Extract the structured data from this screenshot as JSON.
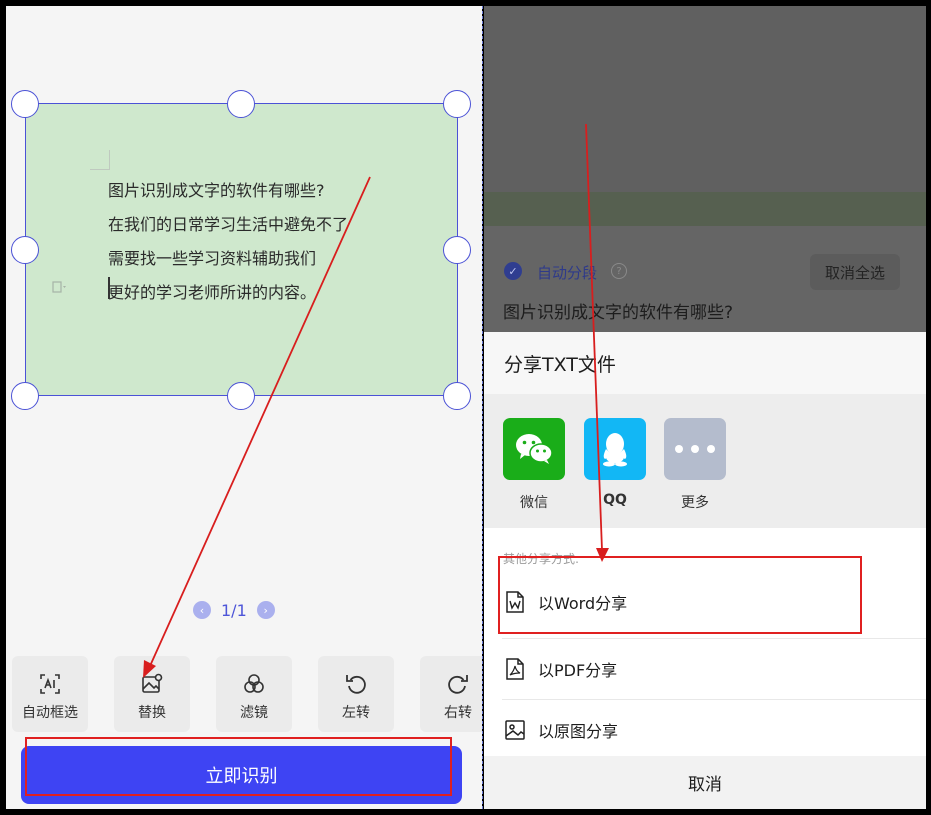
{
  "left_panel": {
    "document_lines": [
      "图片识别成文字的软件有哪些?",
      "在我们的日常学习生活中避免不了",
      "需要找一些学习资料辅助我们",
      "更好的学习老师所讲的内容。"
    ],
    "pager": {
      "prev": "‹",
      "text": "1/1",
      "next": "›"
    },
    "tools": [
      {
        "label": "自动框选",
        "icon": "auto-select-icon"
      },
      {
        "label": "替换",
        "icon": "replace-image-icon"
      },
      {
        "label": "滤镜",
        "icon": "filter-icon"
      },
      {
        "label": "左转",
        "icon": "rotate-left-icon"
      },
      {
        "label": "右转",
        "icon": "rotate-right-icon"
      }
    ],
    "recognize_button": "立即识别"
  },
  "right_panel": {
    "auto_paragraph_label": "自动分段",
    "help_glyph": "?",
    "deselect_all_button": "取消全选",
    "preview_text": "图片识别成文字的软件有哪些?",
    "sheet_title": "分享TXT文件",
    "apps": [
      {
        "label": "微信",
        "icon": "wechat-icon",
        "color": "#1aad19"
      },
      {
        "label": "QQ",
        "icon": "qq-icon",
        "color": "#12b7f5"
      },
      {
        "label": "更多",
        "icon": "more-icon",
        "color": "#b4bccd"
      }
    ],
    "other_methods_label": "其他分享方式:",
    "options": [
      {
        "label": "以Word分享",
        "icon": "word-file-icon"
      },
      {
        "label": "以PDF分享",
        "icon": "pdf-file-icon"
      },
      {
        "label": "以原图分享",
        "icon": "image-file-icon"
      }
    ],
    "cancel_button": "取消"
  },
  "colors": {
    "accent_blue": "#3e44f3",
    "highlight_red": "#e02020",
    "crop_green": "#cfe8cd"
  }
}
